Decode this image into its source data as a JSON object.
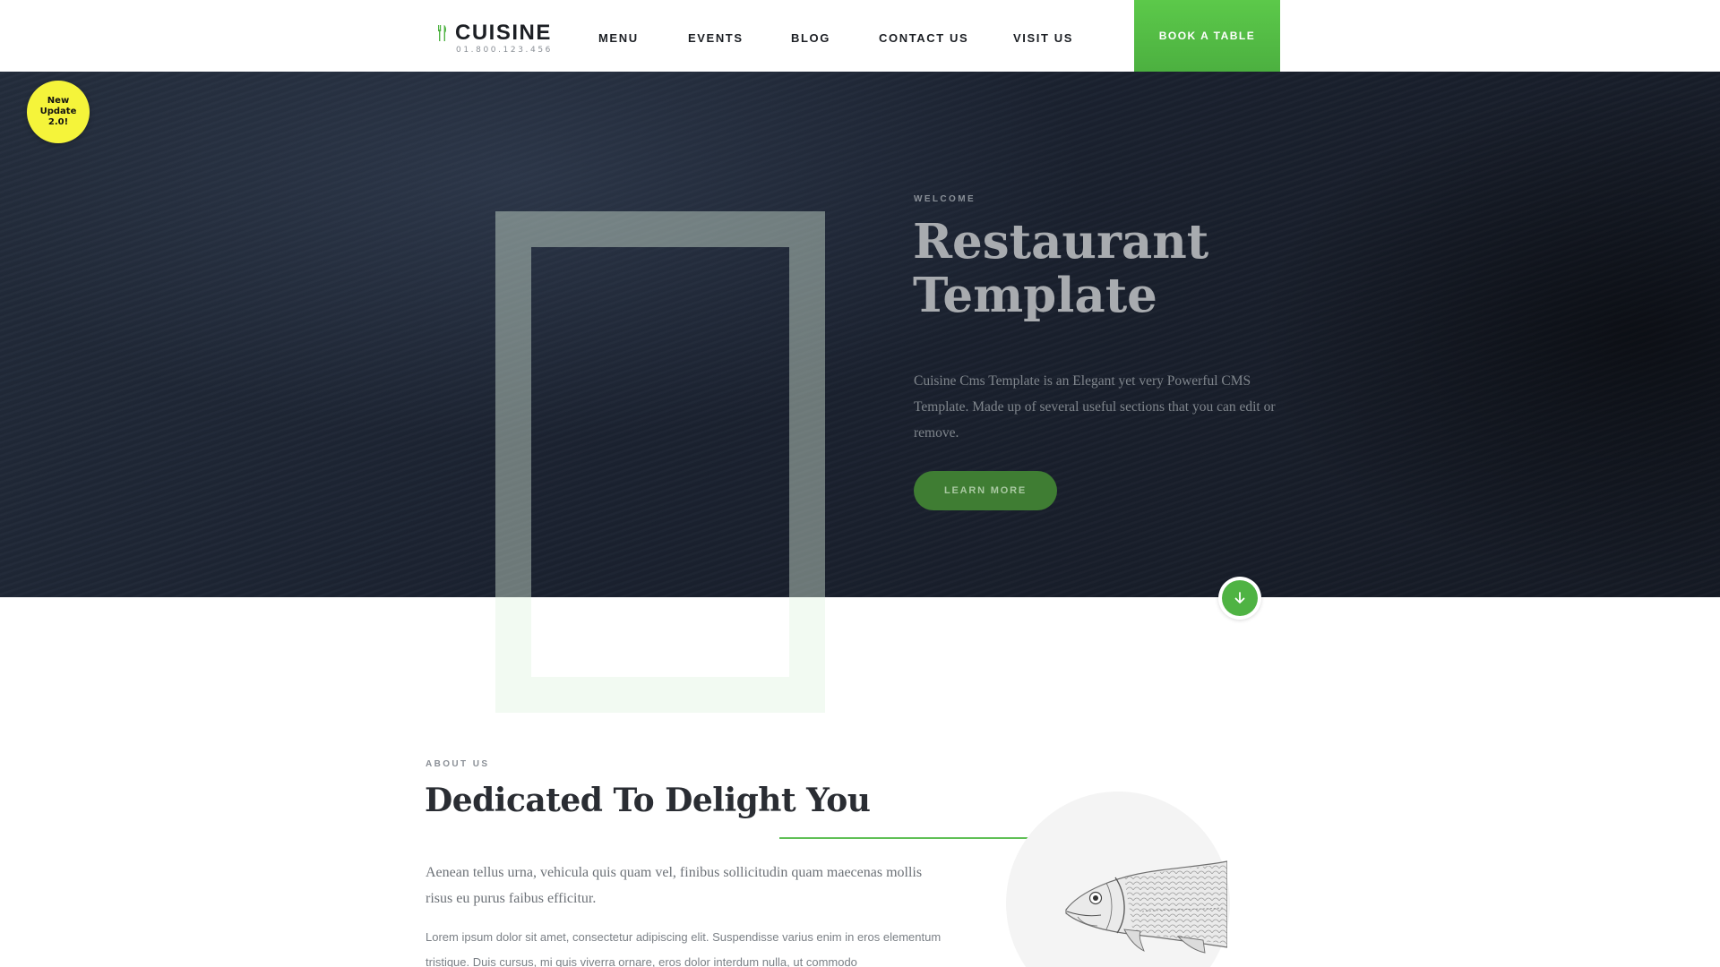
{
  "header": {
    "logo_text": "CUISINE",
    "logo_phone": "01.800.123.456",
    "nav": [
      "MENU",
      "EVENTS",
      "BLOG",
      "CONTACT US",
      "VISIT US"
    ],
    "cta_label": "BOOK A TABLE"
  },
  "badge": {
    "line1": "New",
    "line2": "Update",
    "line3": "2.0!"
  },
  "hero": {
    "eyebrow": "WELCOME",
    "title": "Restaurant Template",
    "description": "Cuisine Cms Template is an Elegant yet very Powerful CMS Template. Made up of several useful sections that you can edit or remove.",
    "button_label": "LEARN MORE"
  },
  "about": {
    "eyebrow": "ABOUT US",
    "title": "Dedicated To Delight You",
    "lead": "Aenean tellus urna, vehicula quis quam vel, finibus sollicitudin quam maecenas mollis risus eu purus faibus efficitur.",
    "body": "Lorem ipsum dolor sit amet, consectetur adipiscing elit. Suspendisse varius enim in eros elementum tristique. Duis cursus, mi quis viverra ornare, eros dolor interdum nulla, ut commodo"
  },
  "colors": {
    "accent": "#5cc94a",
    "badge": "#f5f43a",
    "hero_bg": "#1b2230",
    "learn_button": "#3f7d33"
  },
  "icons": {
    "logo": "fork-knife-icon",
    "scroll": "arrow-down-icon",
    "about_image": "fish-illustration"
  }
}
